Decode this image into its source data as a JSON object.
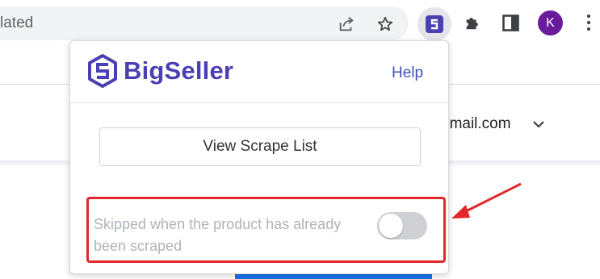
{
  "browser": {
    "address_text": "lated",
    "profile_initial": "K",
    "icons": [
      "share-icon",
      "bookmark-star-icon",
      "bigseller-extension-icon",
      "extensions-puzzle-icon",
      "side-panel-icon",
      "menu-kebab-icon"
    ]
  },
  "page": {
    "account_email": "gmail.com"
  },
  "popup": {
    "brand": "BigSeller",
    "help_label": "Help",
    "view_scrape_list_label": "View Scrape List",
    "skip_setting_label": "Skipped when the product has already been scraped",
    "skip_setting_enabled": false
  },
  "colors": {
    "brand": "#4b3fb4",
    "link": "#3f51b5",
    "annotation": "#e3262b",
    "avatar": "#6a1b9a"
  }
}
